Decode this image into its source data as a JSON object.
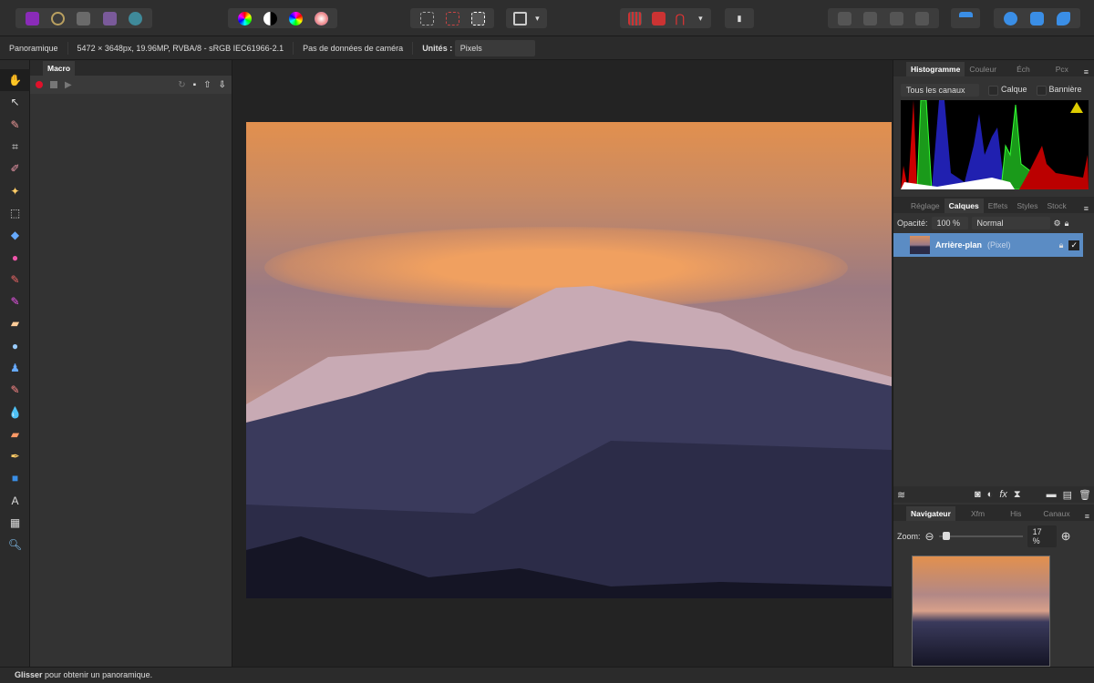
{
  "context": {
    "persona": "Panoramique",
    "doc_info": "5472 × 3648px, 19.96MP, RVBA/8 - sRGB IEC61966-2.1",
    "camera": "Pas de données de caméra",
    "units_label": "Unités :",
    "units_value": "Pixels"
  },
  "macro": {
    "tab": "Macro"
  },
  "histogram": {
    "tabs": [
      "Histogramme",
      "Couleur",
      "Éch",
      "Pcx"
    ],
    "channel": "Tous les canaux",
    "layer_label": "Calque",
    "banner_label": "Bannière"
  },
  "layers": {
    "tabs": [
      "Réglage",
      "Calques",
      "Effets",
      "Styles",
      "Stock"
    ],
    "opacity_label": "Opacité:",
    "opacity": "100 %",
    "blend": "Normal",
    "layer_name": "Arrière-plan",
    "layer_type": "(Pixel)"
  },
  "navigator": {
    "tabs": [
      "Navigateur",
      "Xfm",
      "His",
      "Canaux"
    ],
    "zoom_label": "Zoom:",
    "zoom": "17 %",
    "zoom_fraction": 0.05
  },
  "status": {
    "bold": "Glisser",
    "text": " pour obtenir un panoramique."
  },
  "colors": {
    "accent": "#5b8cc4",
    "record": "#e0102a"
  }
}
